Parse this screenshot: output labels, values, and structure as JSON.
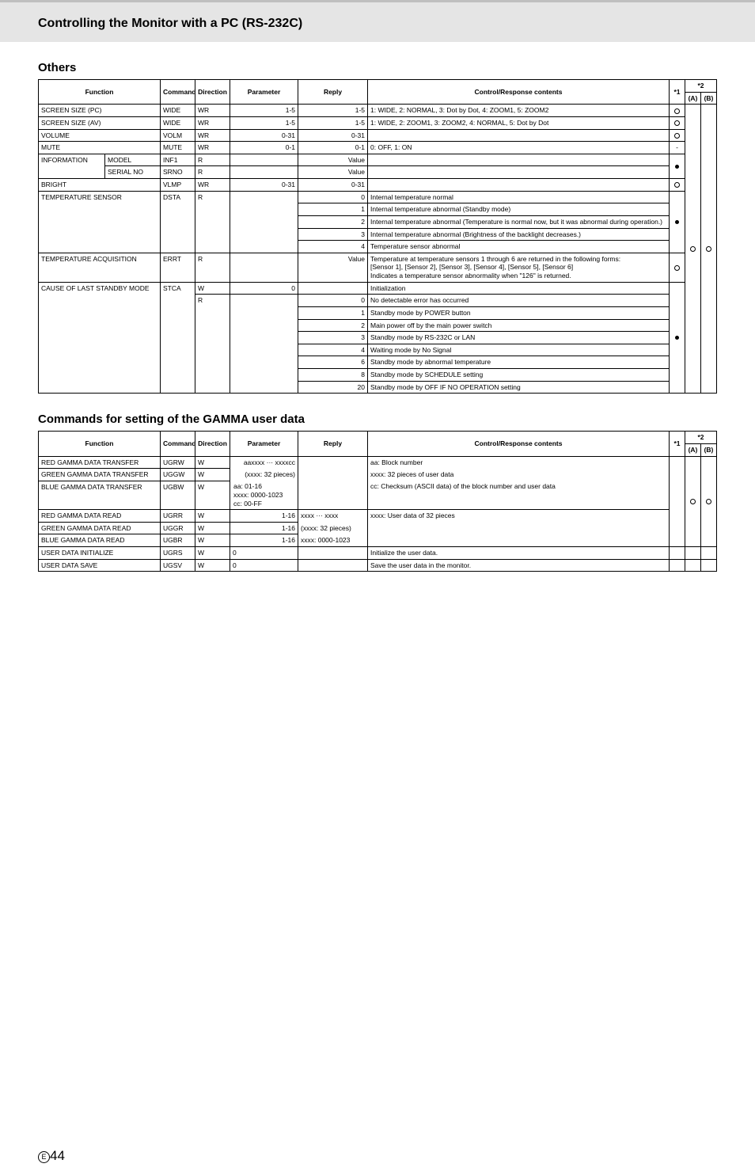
{
  "page_title": "Controlling the Monitor with a PC (RS-232C)",
  "section1_title": "Others",
  "section2_title": "Commands for setting of the GAMMA user data",
  "footer_page": "44",
  "footer_e": "E",
  "headers": {
    "function": "Function",
    "command": "Command",
    "direction": "Direction",
    "parameter": "Parameter",
    "reply": "Reply",
    "control": "Control/Response contents",
    "star1": "*1",
    "star2": "*2",
    "a": "(A)",
    "b": "(B)"
  },
  "t1": {
    "r1": {
      "fn": "SCREEN SIZE (PC)",
      "cmd": "WIDE",
      "dir": "WR",
      "par": "1-5",
      "rep": "1-5",
      "ctl": "1: WIDE, 2: NORMAL, 3: Dot by Dot, 4: ZOOM1, 5: ZOOM2",
      "s1": "open"
    },
    "r2": {
      "fn": "SCREEN SIZE (AV)",
      "cmd": "WIDE",
      "dir": "WR",
      "par": "1-5",
      "rep": "1-5",
      "ctl": "1: WIDE, 2: ZOOM1, 3: ZOOM2, 4: NORMAL, 5: Dot by Dot",
      "s1": "open"
    },
    "r3": {
      "fn": "VOLUME",
      "cmd": "VOLM",
      "dir": "WR",
      "par": "0-31",
      "rep": "0-31",
      "ctl": "",
      "s1": "open"
    },
    "r4": {
      "fn": "MUTE",
      "cmd": "MUTE",
      "dir": "WR",
      "par": "0-1",
      "rep": "0-1",
      "ctl": "0: OFF, 1: ON",
      "s1": "-"
    },
    "r5a": {
      "fn": "INFORMATION",
      "sub": "MODEL",
      "cmd": "INF1",
      "dir": "R",
      "rep": "Value"
    },
    "r5b": {
      "sub": "SERIAL NO",
      "cmd": "SRNO",
      "dir": "R",
      "rep": "Value"
    },
    "r6": {
      "fn": "BRIGHT",
      "cmd": "VLMP",
      "dir": "WR",
      "par": "0-31",
      "rep": "0-31",
      "s1": "open"
    },
    "r7a": {
      "fn": "TEMPERATURE SENSOR",
      "cmd": "DSTA",
      "dir": "R",
      "rep": "0",
      "ctl": "Internal temperature normal"
    },
    "r7b": {
      "rep": "1",
      "ctl": "Internal temperature abnormal (Standby mode)"
    },
    "r7c": {
      "rep": "2",
      "ctl": "Internal temperature abnormal (Temperature is normal now, but it was abnormal during operation.)"
    },
    "r7d": {
      "rep": "3",
      "ctl": "Internal temperature abnormal (Brightness of the backlight decreases.)"
    },
    "r7e": {
      "rep": "4",
      "ctl": "Temperature sensor abnormal"
    },
    "r8": {
      "fn": "TEMPERATURE ACQUISITION",
      "cmd": "ERRT",
      "dir": "R",
      "rep": "Value",
      "ctl": "Temperature at temperature sensors 1 through 6 are returned in the following forms:\n[Sensor 1], [Sensor 2], [Sensor 3], [Sensor 4], [Sensor 5], [Sensor 6]\nIndicates a temperature sensor abnormality when \"126\" is returned.",
      "s1": "open"
    },
    "r9a": {
      "fn": "CAUSE OF LAST STANDBY MODE",
      "cmd": "STCA",
      "dir": "W",
      "par": "0",
      "ctl": "Initialization"
    },
    "r9b": {
      "dir": "R",
      "rep": "0",
      "ctl": "No detectable error has occurred"
    },
    "r9c": {
      "rep": "1",
      "ctl": "Standby mode by POWER button"
    },
    "r9d": {
      "rep": "2",
      "ctl": "Main power off by the main power switch"
    },
    "r9e": {
      "rep": "3",
      "ctl": "Standby mode by RS-232C or LAN"
    },
    "r9f": {
      "rep": "4",
      "ctl": "Waiting mode by No Signal"
    },
    "r9g": {
      "rep": "6",
      "ctl": "Standby mode by abnormal temperature"
    },
    "r9h": {
      "rep": "8",
      "ctl": "Standby mode by SCHEDULE setting"
    },
    "r9i": {
      "rep": "20",
      "ctl": "Standby mode by OFF IF NO OPERATION setting"
    }
  },
  "t2": {
    "r1": {
      "fn": "RED GAMMA DATA TRANSFER",
      "cmd": "UGRW",
      "dir": "W",
      "par": "aaxxxx ··· xxxxcc",
      "ctl": "aa: Block number"
    },
    "r2": {
      "fn": "GREEN GAMMA DATA TRANSFER",
      "cmd": "UGGW",
      "dir": "W",
      "par": "(xxxx: 32 pieces)",
      "ctl": "xxxx: 32 pieces of user data"
    },
    "r3": {
      "fn": "BLUE GAMMA DATA TRANSFER",
      "cmd": "UGBW",
      "dir": "W",
      "par": "aa: 01-16\nxxxx: 0000-1023\ncc: 00-FF",
      "ctl": "cc: Checksum (ASCII data) of the block number and user data"
    },
    "r4": {
      "fn": "RED GAMMA DATA READ",
      "cmd": "UGRR",
      "dir": "W",
      "par": "1-16",
      "rep": "xxxx ··· xxxx",
      "ctl": "xxxx: User data of 32 pieces"
    },
    "r5": {
      "fn": "GREEN GAMMA DATA READ",
      "cmd": "UGGR",
      "dir": "W",
      "par": "1-16",
      "rep": "(xxxx: 32 pieces)"
    },
    "r6": {
      "fn": "BLUE GAMMA DATA READ",
      "cmd": "UGBR",
      "dir": "W",
      "par": "1-16",
      "rep": "xxxx: 0000-1023"
    },
    "r7": {
      "fn": "USER DATA INITIALIZE",
      "cmd": "UGRS",
      "dir": "W",
      "par": "0",
      "ctl": "Initialize the user data."
    },
    "r8": {
      "fn": "USER DATA SAVE",
      "cmd": "UGSV",
      "dir": "W",
      "par": "0",
      "ctl": "Save the user data in the monitor."
    }
  }
}
